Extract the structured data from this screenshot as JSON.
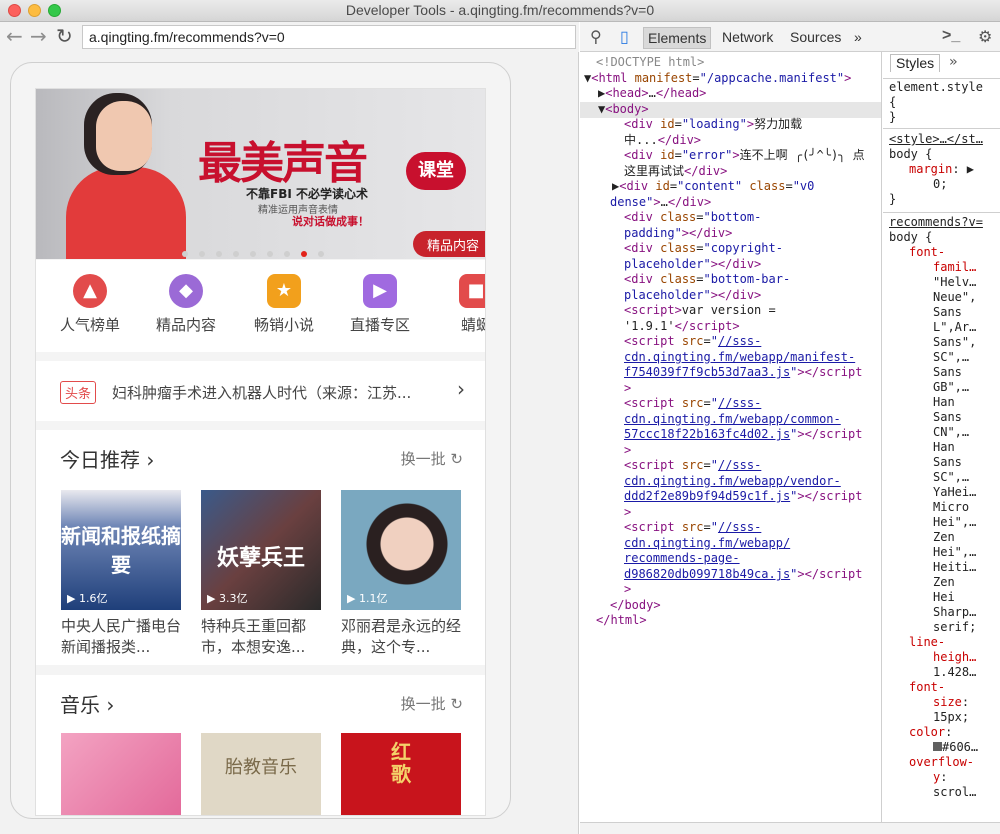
{
  "window": {
    "title": "Developer Tools - a.qingting.fm/recommends?v=0"
  },
  "browser": {
    "url": "a.qingting.fm/recommends?v=0"
  },
  "app": {
    "banner": {
      "title": "最美声音",
      "title_tag": "课堂",
      "subtitle": "不靠FBI 不必学读心术",
      "line2": "精准运用声音表情",
      "line3": "说对话做成事！",
      "badge": "精品内容"
    },
    "categories": [
      {
        "label": "人气榜单",
        "icon": "fire-icon",
        "color": "#e24b4b"
      },
      {
        "label": "精品内容",
        "icon": "diamond-icon",
        "color": "#9b6ad6"
      },
      {
        "label": "畅销小说",
        "icon": "star-book-icon",
        "color": "#f2a01c"
      },
      {
        "label": "直播专区",
        "icon": "video-icon",
        "color": "#a06ae0"
      },
      {
        "label": "蜻蜓",
        "icon": "store-icon",
        "color": "#e24b4b"
      }
    ],
    "news": {
      "tag": "头条",
      "text": "妇科肿瘤手术进入机器人时代（来源：江苏..."
    },
    "today": {
      "title": "今日推荐",
      "refresh": "换一批",
      "cards": [
        {
          "thumb_text": "新闻和报纸摘要",
          "count": "1.6亿",
          "title": "中央人民广播电台新闻播报类...",
          "color": "#1f3f7a"
        },
        {
          "thumb_text": "妖孽兵王",
          "count": "3.3亿",
          "title": "特种兵王重回都市，本想安逸...",
          "color": "#4a3030"
        },
        {
          "thumb_text": "",
          "count": "1.1亿",
          "title": "邓丽君是永远的经典，这个专...",
          "color": "#5a88a0"
        }
      ]
    },
    "music": {
      "title": "音乐",
      "refresh": "换一批",
      "cards": [
        {
          "thumb_text": "",
          "color": "#e87aa4"
        },
        {
          "thumb_text": "胎教音乐",
          "color": "#d8d0bf"
        },
        {
          "thumb_text": "红歌",
          "color": "#c8141c"
        }
      ]
    }
  },
  "devtools": {
    "tabs": [
      "Elements",
      "Network",
      "Sources"
    ],
    "more": "»",
    "styles_tab": "Styles",
    "elements_lines": [
      {
        "indent": 0,
        "html": "<span class=\"cmt\">&lt;!DOCTYPE html&gt;</span>"
      }
    ],
    "styles_lines": []
  }
}
